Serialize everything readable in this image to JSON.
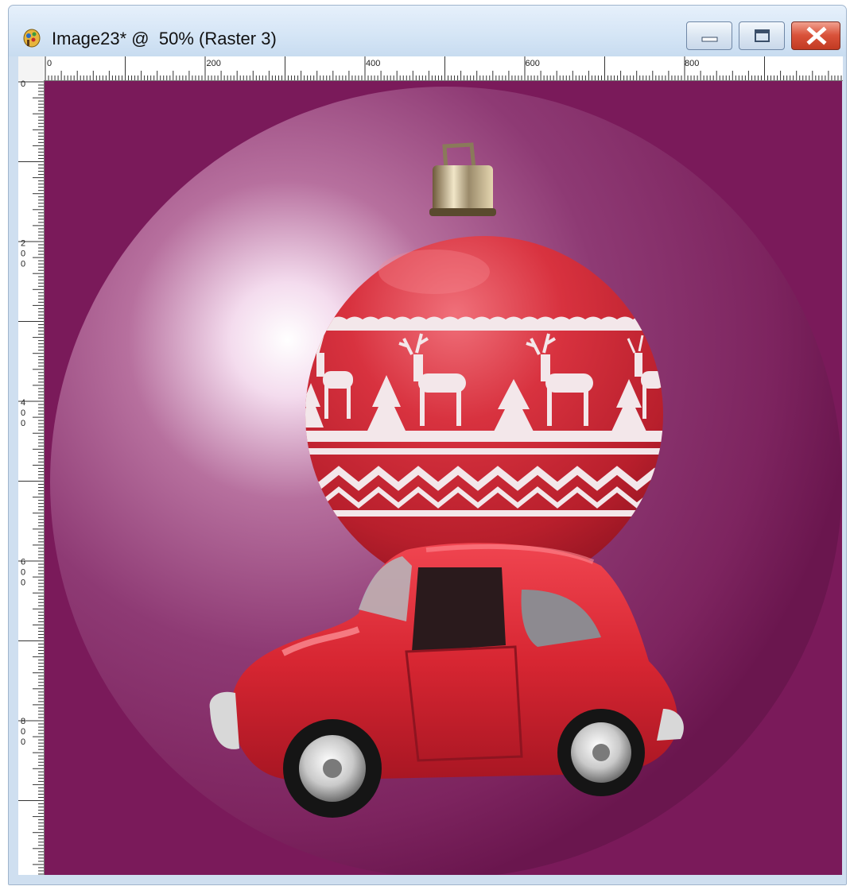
{
  "window": {
    "title": "Image23* @  50% (Raster 3)",
    "app_icon": "paint-app-icon",
    "buttons": {
      "minimize": "minimize-icon",
      "maximize": "maximize-icon",
      "close": "close-icon"
    }
  },
  "ruler": {
    "horizontal_labels": [
      "0",
      "200",
      "400",
      "600",
      "800"
    ],
    "vertical_labels": [
      "0",
      "200",
      "400",
      "600",
      "800"
    ]
  },
  "canvas": {
    "background_color": "#7a1a5a",
    "glow_color": "#ffffff",
    "ornament_color": "#d92f3e",
    "car_color": "#e02a35",
    "pattern_color": "#f3e7ea",
    "subject": "red toy car carrying a red christmas ornament with reindeer pattern"
  }
}
